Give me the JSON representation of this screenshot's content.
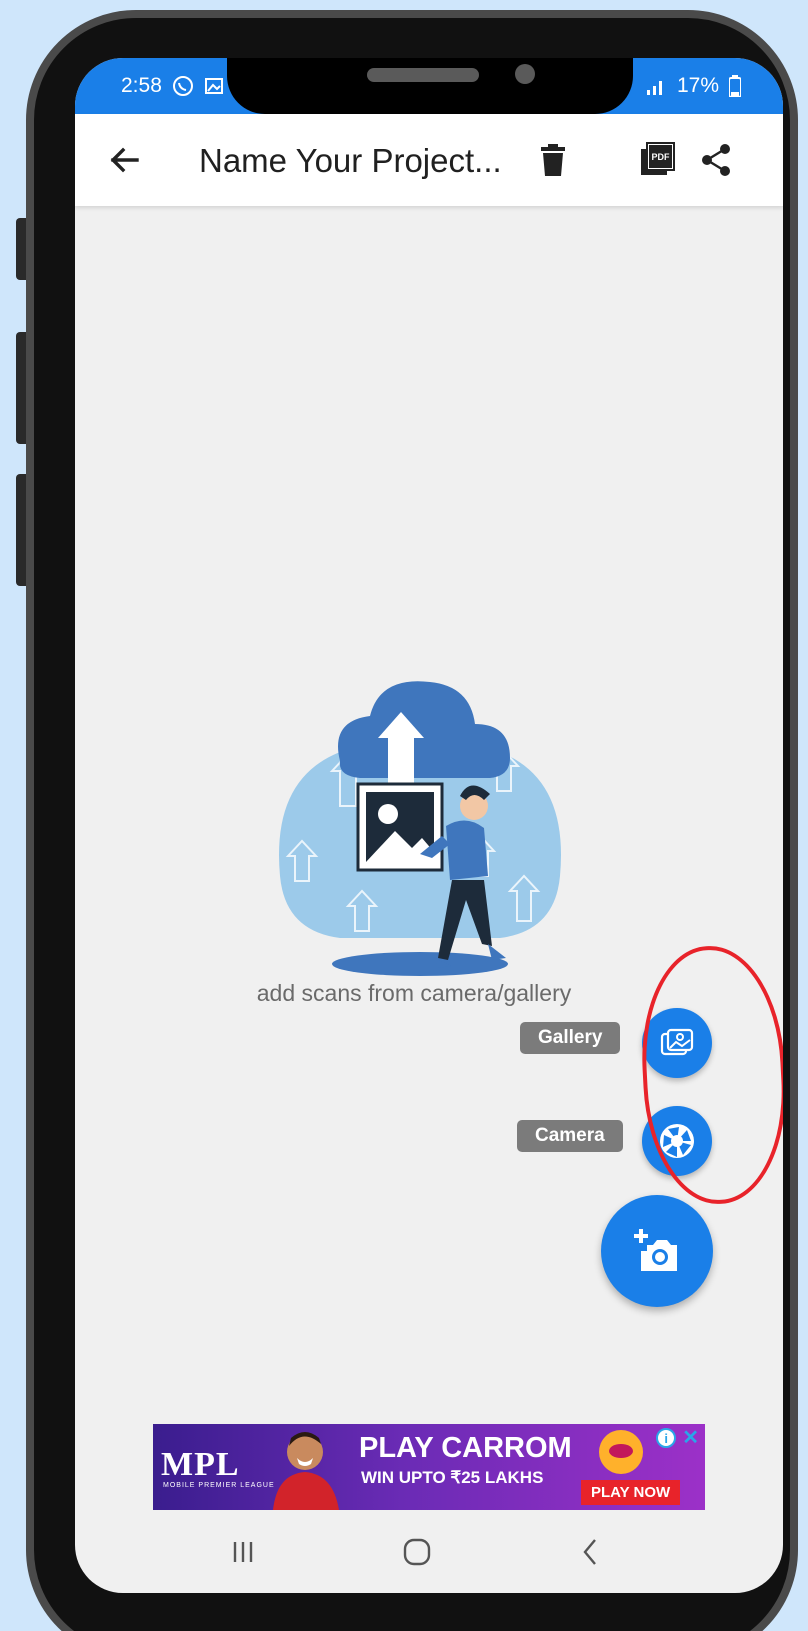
{
  "status_bar": {
    "time": "2:58",
    "battery": "17%"
  },
  "app_bar": {
    "title": "Name Your Project..."
  },
  "empty_state": {
    "message": "add scans from camera/gallery"
  },
  "fab_menu": {
    "gallery_label": "Gallery",
    "camera_label": "Camera"
  },
  "ad": {
    "brand": "MPL",
    "brand_sub": "MOBILE PREMIER LEAGUE",
    "headline": "PLAY CARROM",
    "subline": "WIN UPTO ₹25 LAKHS",
    "cta": "PLAY NOW"
  },
  "colors": {
    "accent": "#1a7fe8",
    "highlight": "#e8232a",
    "background": "#cfe6fb"
  },
  "icons": {
    "back": "arrow-left-icon",
    "delete": "trash-icon",
    "pdf": "pdf-icon",
    "share": "share-icon",
    "gallery": "image-icon",
    "camera": "camera-shutter-icon",
    "add_photo": "add-photo-icon"
  }
}
